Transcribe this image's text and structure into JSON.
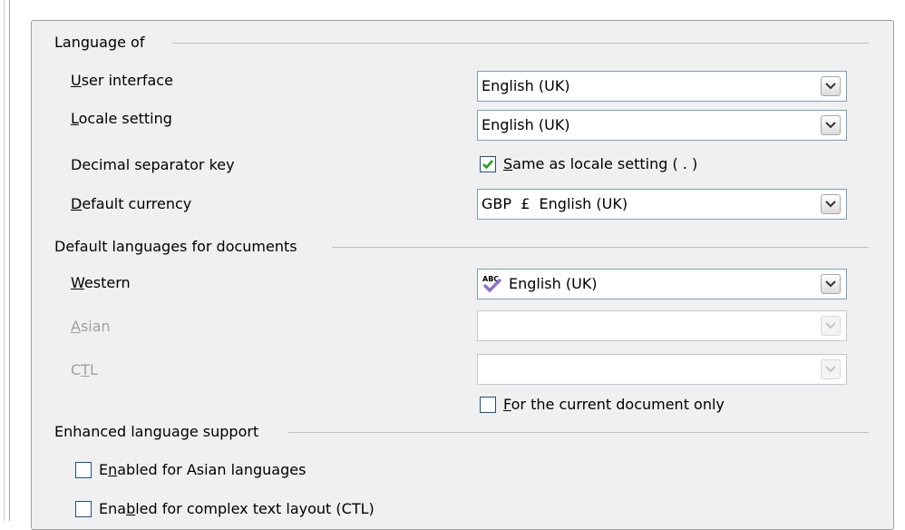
{
  "sections": {
    "language_of": "Language of",
    "default_languages": "Default languages for documents",
    "enhanced": "Enhanced language support"
  },
  "language_of": {
    "user_interface": {
      "label_ul": "U",
      "label_rest": "ser interface",
      "value": "English (UK)"
    },
    "locale_setting": {
      "label_ul": "L",
      "label_rest": "ocale setting",
      "value": "English (UK)"
    },
    "decimal_separator": {
      "label": "Decimal separator key",
      "checkbox_ul": "S",
      "checkbox_rest": "ame as locale setting ( . )",
      "checked": true
    },
    "default_currency": {
      "label_ul": "D",
      "label_rest": "efault currency",
      "value": "GBP  £  English (UK)"
    }
  },
  "default_languages": {
    "western": {
      "label_ul": "W",
      "label_rest": "estern",
      "value": "English (UK)",
      "icon": "spellcheck-abc-icon"
    },
    "asian": {
      "label_ul": "A",
      "label_rest": "sian",
      "value": ""
    },
    "ctl": {
      "label_pre": "C",
      "label_ul": "T",
      "label_rest": "L",
      "value": ""
    },
    "current_doc_only": {
      "label_ul": "F",
      "label_rest": "or the current document only",
      "checked": false
    }
  },
  "enhanced": {
    "asian": {
      "label_pre": "E",
      "label_ul": "n",
      "label_rest": "abled for Asian languages",
      "checked": false
    },
    "ctl": {
      "label_pre": "Ena",
      "label_ul": "b",
      "label_rest": "led for complex text layout (CTL)",
      "checked": false
    }
  },
  "colors": {
    "panel_bg": "#f0f0f0",
    "check_green": "#21a121",
    "disabled_text": "#a0a0a0"
  }
}
